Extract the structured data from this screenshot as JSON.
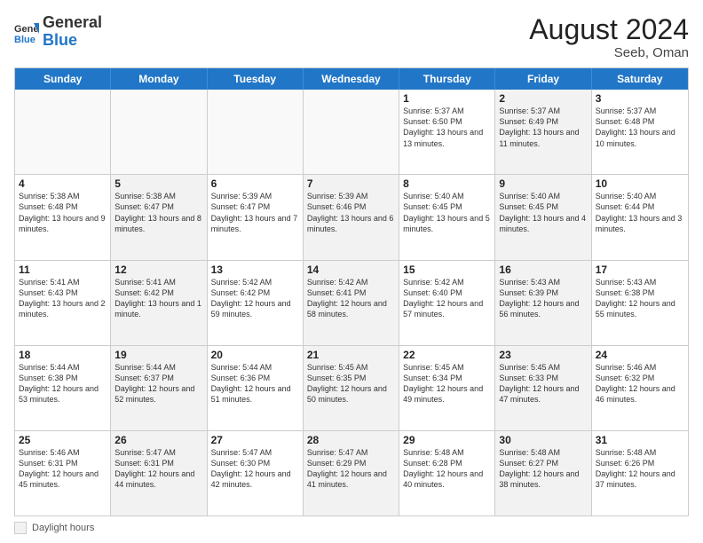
{
  "header": {
    "logo_general": "General",
    "logo_blue": "Blue",
    "month_year": "August 2024",
    "location": "Seeb, Oman"
  },
  "days_of_week": [
    "Sunday",
    "Monday",
    "Tuesday",
    "Wednesday",
    "Thursday",
    "Friday",
    "Saturday"
  ],
  "weeks": [
    [
      {
        "day": "",
        "text": "",
        "empty": true
      },
      {
        "day": "",
        "text": "",
        "empty": true
      },
      {
        "day": "",
        "text": "",
        "empty": true
      },
      {
        "day": "",
        "text": "",
        "empty": true
      },
      {
        "day": "1",
        "text": "Sunrise: 5:37 AM\nSunset: 6:50 PM\nDaylight: 13 hours\nand 13 minutes.",
        "shaded": false
      },
      {
        "day": "2",
        "text": "Sunrise: 5:37 AM\nSunset: 6:49 PM\nDaylight: 13 hours\nand 11 minutes.",
        "shaded": true
      },
      {
        "day": "3",
        "text": "Sunrise: 5:37 AM\nSunset: 6:48 PM\nDaylight: 13 hours\nand 10 minutes.",
        "shaded": false
      }
    ],
    [
      {
        "day": "4",
        "text": "Sunrise: 5:38 AM\nSunset: 6:48 PM\nDaylight: 13 hours\nand 9 minutes.",
        "shaded": false
      },
      {
        "day": "5",
        "text": "Sunrise: 5:38 AM\nSunset: 6:47 PM\nDaylight: 13 hours\nand 8 minutes.",
        "shaded": true
      },
      {
        "day": "6",
        "text": "Sunrise: 5:39 AM\nSunset: 6:47 PM\nDaylight: 13 hours\nand 7 minutes.",
        "shaded": false
      },
      {
        "day": "7",
        "text": "Sunrise: 5:39 AM\nSunset: 6:46 PM\nDaylight: 13 hours\nand 6 minutes.",
        "shaded": true
      },
      {
        "day": "8",
        "text": "Sunrise: 5:40 AM\nSunset: 6:45 PM\nDaylight: 13 hours\nand 5 minutes.",
        "shaded": false
      },
      {
        "day": "9",
        "text": "Sunrise: 5:40 AM\nSunset: 6:45 PM\nDaylight: 13 hours\nand 4 minutes.",
        "shaded": true
      },
      {
        "day": "10",
        "text": "Sunrise: 5:40 AM\nSunset: 6:44 PM\nDaylight: 13 hours\nand 3 minutes.",
        "shaded": false
      }
    ],
    [
      {
        "day": "11",
        "text": "Sunrise: 5:41 AM\nSunset: 6:43 PM\nDaylight: 13 hours\nand 2 minutes.",
        "shaded": false
      },
      {
        "day": "12",
        "text": "Sunrise: 5:41 AM\nSunset: 6:42 PM\nDaylight: 13 hours\nand 1 minute.",
        "shaded": true
      },
      {
        "day": "13",
        "text": "Sunrise: 5:42 AM\nSunset: 6:42 PM\nDaylight: 12 hours\nand 59 minutes.",
        "shaded": false
      },
      {
        "day": "14",
        "text": "Sunrise: 5:42 AM\nSunset: 6:41 PM\nDaylight: 12 hours\nand 58 minutes.",
        "shaded": true
      },
      {
        "day": "15",
        "text": "Sunrise: 5:42 AM\nSunset: 6:40 PM\nDaylight: 12 hours\nand 57 minutes.",
        "shaded": false
      },
      {
        "day": "16",
        "text": "Sunrise: 5:43 AM\nSunset: 6:39 PM\nDaylight: 12 hours\nand 56 minutes.",
        "shaded": true
      },
      {
        "day": "17",
        "text": "Sunrise: 5:43 AM\nSunset: 6:38 PM\nDaylight: 12 hours\nand 55 minutes.",
        "shaded": false
      }
    ],
    [
      {
        "day": "18",
        "text": "Sunrise: 5:44 AM\nSunset: 6:38 PM\nDaylight: 12 hours\nand 53 minutes.",
        "shaded": false
      },
      {
        "day": "19",
        "text": "Sunrise: 5:44 AM\nSunset: 6:37 PM\nDaylight: 12 hours\nand 52 minutes.",
        "shaded": true
      },
      {
        "day": "20",
        "text": "Sunrise: 5:44 AM\nSunset: 6:36 PM\nDaylight: 12 hours\nand 51 minutes.",
        "shaded": false
      },
      {
        "day": "21",
        "text": "Sunrise: 5:45 AM\nSunset: 6:35 PM\nDaylight: 12 hours\nand 50 minutes.",
        "shaded": true
      },
      {
        "day": "22",
        "text": "Sunrise: 5:45 AM\nSunset: 6:34 PM\nDaylight: 12 hours\nand 49 minutes.",
        "shaded": false
      },
      {
        "day": "23",
        "text": "Sunrise: 5:45 AM\nSunset: 6:33 PM\nDaylight: 12 hours\nand 47 minutes.",
        "shaded": true
      },
      {
        "day": "24",
        "text": "Sunrise: 5:46 AM\nSunset: 6:32 PM\nDaylight: 12 hours\nand 46 minutes.",
        "shaded": false
      }
    ],
    [
      {
        "day": "25",
        "text": "Sunrise: 5:46 AM\nSunset: 6:31 PM\nDaylight: 12 hours\nand 45 minutes.",
        "shaded": false
      },
      {
        "day": "26",
        "text": "Sunrise: 5:47 AM\nSunset: 6:31 PM\nDaylight: 12 hours\nand 44 minutes.",
        "shaded": true
      },
      {
        "day": "27",
        "text": "Sunrise: 5:47 AM\nSunset: 6:30 PM\nDaylight: 12 hours\nand 42 minutes.",
        "shaded": false
      },
      {
        "day": "28",
        "text": "Sunrise: 5:47 AM\nSunset: 6:29 PM\nDaylight: 12 hours\nand 41 minutes.",
        "shaded": true
      },
      {
        "day": "29",
        "text": "Sunrise: 5:48 AM\nSunset: 6:28 PM\nDaylight: 12 hours\nand 40 minutes.",
        "shaded": false
      },
      {
        "day": "30",
        "text": "Sunrise: 5:48 AM\nSunset: 6:27 PM\nDaylight: 12 hours\nand 38 minutes.",
        "shaded": true
      },
      {
        "day": "31",
        "text": "Sunrise: 5:48 AM\nSunset: 6:26 PM\nDaylight: 12 hours\nand 37 minutes.",
        "shaded": false
      }
    ]
  ],
  "footer": {
    "label": "Daylight hours"
  }
}
